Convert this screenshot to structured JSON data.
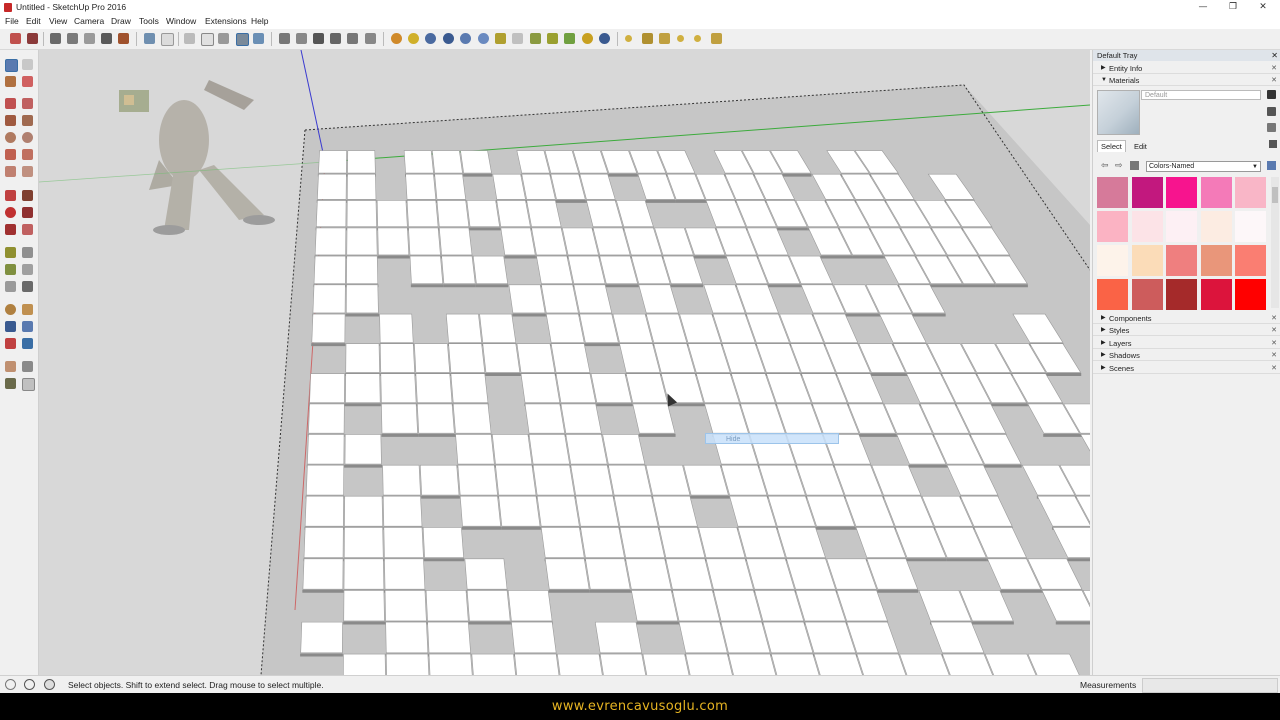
{
  "window": {
    "title": "Untitled - SketchUp Pro 2016",
    "minimize": "—",
    "maximize": "❐",
    "close": "✕"
  },
  "menu": [
    "File",
    "Edit",
    "View",
    "Camera",
    "Draw",
    "Tools",
    "Window",
    "Extensions",
    "Help"
  ],
  "viewport": {
    "tooltip": "Hide"
  },
  "tray": {
    "title": "Default Tray",
    "panels_top": [
      "Entity Info",
      "Materials"
    ],
    "material_name_placeholder": "Default",
    "tabs": {
      "select": "Select",
      "edit": "Edit"
    },
    "collection": "Colors-Named",
    "swatch_colors": [
      "#d67a9a",
      "#c2187e",
      "#f7148e",
      "#f47ab8",
      "#f9b6c7",
      "#fbb3c3",
      "#fce3e7",
      "#fdf0f4",
      "#fcece2",
      "#fdf7f9",
      "#fdf3ea",
      "#fbdcb8",
      "#ef7f7f",
      "#e9967a",
      "#fa7e72",
      "#fa6346",
      "#cd5c5c",
      "#a52a2a",
      "#dc143c",
      "#ff0000"
    ],
    "panels_bottom": [
      "Components",
      "Styles",
      "Layers",
      "Shadows",
      "Scenes"
    ]
  },
  "status": {
    "message": "Select objects. Shift to extend select. Drag mouse to select multiple.",
    "measurements_label": "Measurements"
  },
  "footer": {
    "url": "www.evrencavusoglu.com"
  }
}
